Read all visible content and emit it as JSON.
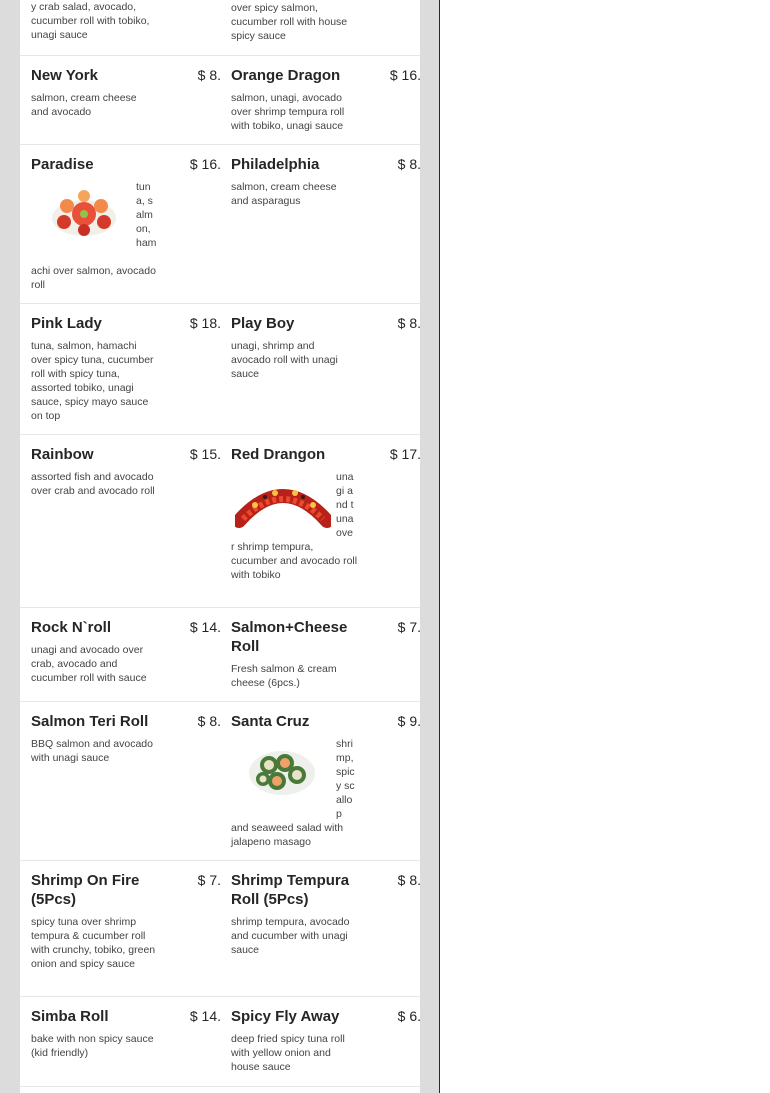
{
  "items": {
    "top_left": {
      "desc": "y crab salad, avocado, cucumber roll with tobiko, unagi sauce"
    },
    "top_right": {
      "desc": "over spicy salmon, cucumber roll with house spicy sauce"
    },
    "new_york": {
      "name": "New York",
      "price": "$ 8.",
      "desc": "salmon, cream cheese and avocado"
    },
    "orange_dragon": {
      "name": "Orange Dragon",
      "price": "$ 16.",
      "desc": "salmon, unagi, avocado over shrimp tempura roll with tobiko, unagi sauce"
    },
    "paradise": {
      "name": "Paradise",
      "price": "$ 16.",
      "desc_side": "tuna, salmon, ham",
      "desc_rest": "achi over salmon, avocado roll"
    },
    "philadelphia": {
      "name": "Philadelphia",
      "price": "$ 8.",
      "desc": "salmon, cream cheese and asparagus"
    },
    "pink_lady": {
      "name": "Pink Lady",
      "price": "$ 18.",
      "desc": "tuna, salmon, hamachi over spicy tuna, cucumber roll with spicy tuna, assorted tobiko, unagi sauce, spicy mayo sauce on top"
    },
    "play_boy": {
      "name": "Play Boy",
      "price": "$ 8.",
      "desc": "unagi, shrimp and avocado roll with unagi sauce"
    },
    "rainbow": {
      "name": "Rainbow",
      "price": "$ 15.",
      "desc": "assorted fish and avocado over crab and avocado roll"
    },
    "red_drangon": {
      "name": "Red Drangon",
      "price": "$ 17.",
      "desc_side": "unagi and tuna ove",
      "desc_rest": "r shrimp tempura, cucumber and avocado roll with tobiko"
    },
    "rock_n_roll": {
      "name": "Rock N`roll",
      "price": "$ 14.",
      "desc": "unagi and avocado over crab, avocado and cucumber roll with sauce"
    },
    "salmon_cheese": {
      "name": "Salmon+Cheese Roll",
      "price": "$ 7.",
      "desc": "Fresh salmon & cream cheese (6pcs.)"
    },
    "salmon_teri": {
      "name": "Salmon Teri Roll",
      "price": "$ 8.",
      "desc": "BBQ salmon and avocado with unagi sauce"
    },
    "santa_cruz": {
      "name": "Santa Cruz",
      "price": "$ 9.",
      "desc_side": "shrimp, spicy scallop",
      "desc_rest": "and seaweed salad with jalapeno masago"
    },
    "shrimp_on_fire": {
      "name": "Shrimp On Fire (5Pcs)",
      "price": "$ 7.",
      "desc": "spicy tuna over shrimp tempura & cucumber roll with crunchy, tobiko, green onion and spicy sauce"
    },
    "shrimp_tempura": {
      "name": "Shrimp Tempura Roll (5Pcs)",
      "price": "$ 8.",
      "desc": "shrimp tempura, avocado and cucumber with unagi sauce"
    },
    "simba": {
      "name": "Simba Roll",
      "price": "$ 14.",
      "desc": "bake with non spicy sauce (kid friendly)"
    },
    "spicy_fly_away": {
      "name": "Spicy Fly Away",
      "price": "$ 6.",
      "desc": "deep fried spicy tuna roll with yellow onion and house sauce"
    }
  }
}
